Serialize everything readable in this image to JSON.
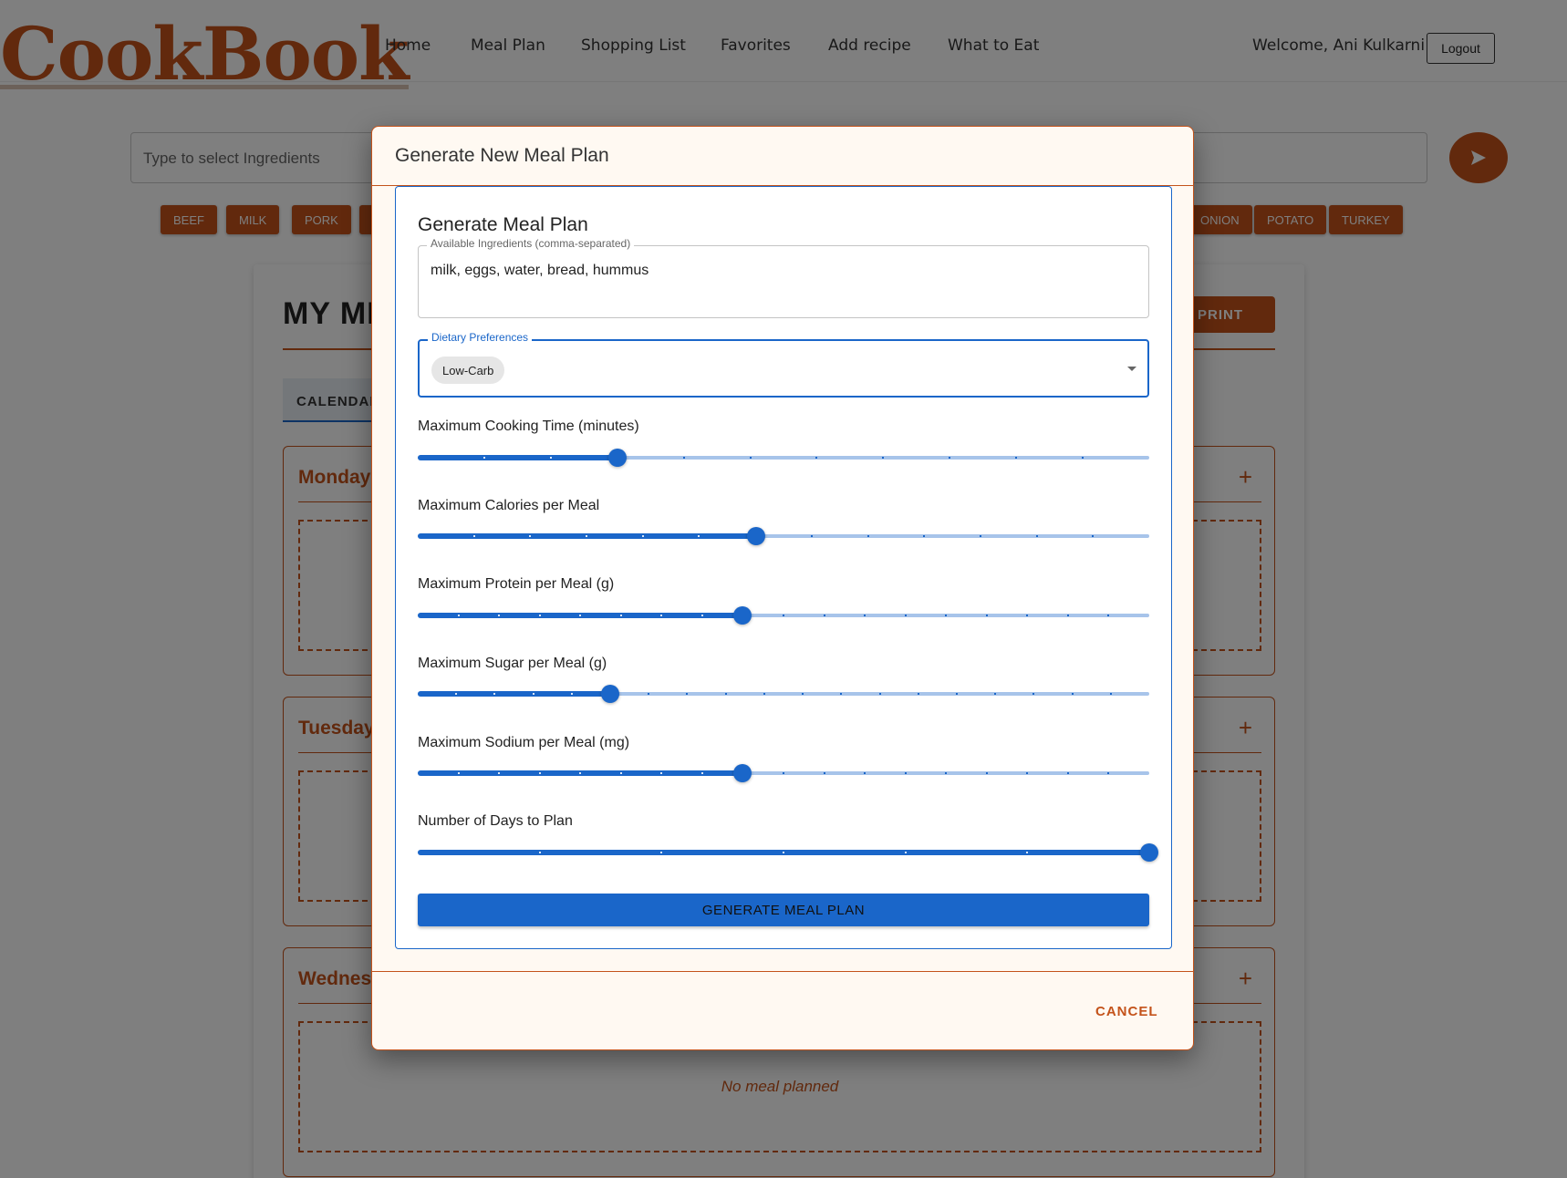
{
  "app": {
    "logo": "CookBook"
  },
  "nav": {
    "links": [
      "Home",
      "Meal Plan",
      "Shopping List",
      "Favorites",
      "Add recipe",
      "What to Eat"
    ],
    "welcome": "Welcome, Ani Kulkarni",
    "logout": "Logout"
  },
  "search": {
    "placeholder": "Type to select Ingredients"
  },
  "tags_left": [
    "BEEF",
    "MILK",
    "PORK"
  ],
  "tags_right": [
    "ONION",
    "POTATO",
    "TURKEY"
  ],
  "page": {
    "title": "MY MI",
    "print": "PRINT",
    "tab": "CALENDAR",
    "days": [
      "Monday",
      "Tuesday",
      "Wednes"
    ],
    "empty_text": "No meal planned"
  },
  "dialog": {
    "title": "Generate New Meal Plan",
    "card_title": "Generate Meal Plan",
    "ingredients": {
      "label": "Available Ingredients (comma-separated)",
      "value": "milk, eggs, water, bread, hummus"
    },
    "dietary": {
      "label": "Dietary Preferences",
      "selected": "Low-Carb"
    },
    "sliders": [
      {
        "label": "Maximum Cooking Time (minutes)",
        "fraction": 0.273,
        "steps": 11
      },
      {
        "label": "Maximum Calories per Meal",
        "fraction": 0.462,
        "steps": 13
      },
      {
        "label": "Maximum Protein per Meal (g)",
        "fraction": 0.444,
        "steps": 18
      },
      {
        "label": "Maximum Sugar per Meal (g)",
        "fraction": 0.263,
        "steps": 19
      },
      {
        "label": "Maximum Sodium per Meal (mg)",
        "fraction": 0.444,
        "steps": 18
      },
      {
        "label": "Number of Days to Plan",
        "fraction": 1.0,
        "steps": 6
      }
    ],
    "generate_button": "GENERATE MEAL PLAN",
    "cancel_button": "CANCEL"
  },
  "colors": {
    "brand": "#c4531b",
    "accent": "#1a66c9",
    "rail": "#a7c4ea"
  }
}
